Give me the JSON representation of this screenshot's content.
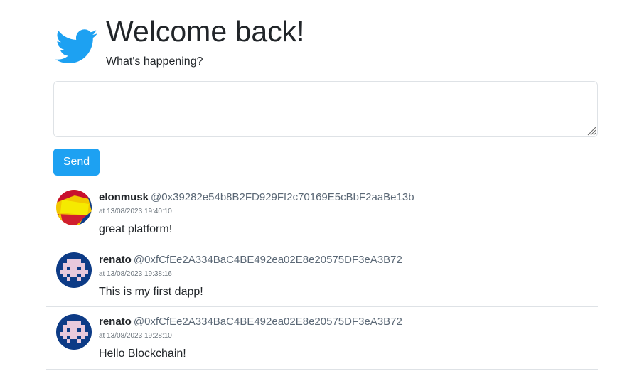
{
  "header": {
    "logo_icon": "twitter-bird-icon",
    "brand_color": "#1da1f2",
    "title": "Welcome back!",
    "subtitle": "What's happening?"
  },
  "composer": {
    "value": "",
    "send_label": "Send"
  },
  "tweets": [
    {
      "username": "elonmusk",
      "address": "@0x39282e54b8B2FD929Ff2c70169E5cBbF2aaBe13b",
      "timestamp": "at 13/08/2023 19:40:10",
      "text": "great platform!",
      "avatar_icon": "geometric-avatar-icon"
    },
    {
      "username": "renato",
      "address": "@0xfCfEe2A334BaC4BE492ea02E8e20575DF3eA3B72",
      "timestamp": "at 13/08/2023 19:38:16",
      "text": "This is my first dapp!",
      "avatar_icon": "pixel-avatar-icon"
    },
    {
      "username": "renato",
      "address": "@0xfCfEe2A334BaC4BE492ea02E8e20575DF3eA3B72",
      "timestamp": "at 13/08/2023 19:28:10",
      "text": "Hello Blockchain!",
      "avatar_icon": "pixel-avatar-icon"
    }
  ]
}
